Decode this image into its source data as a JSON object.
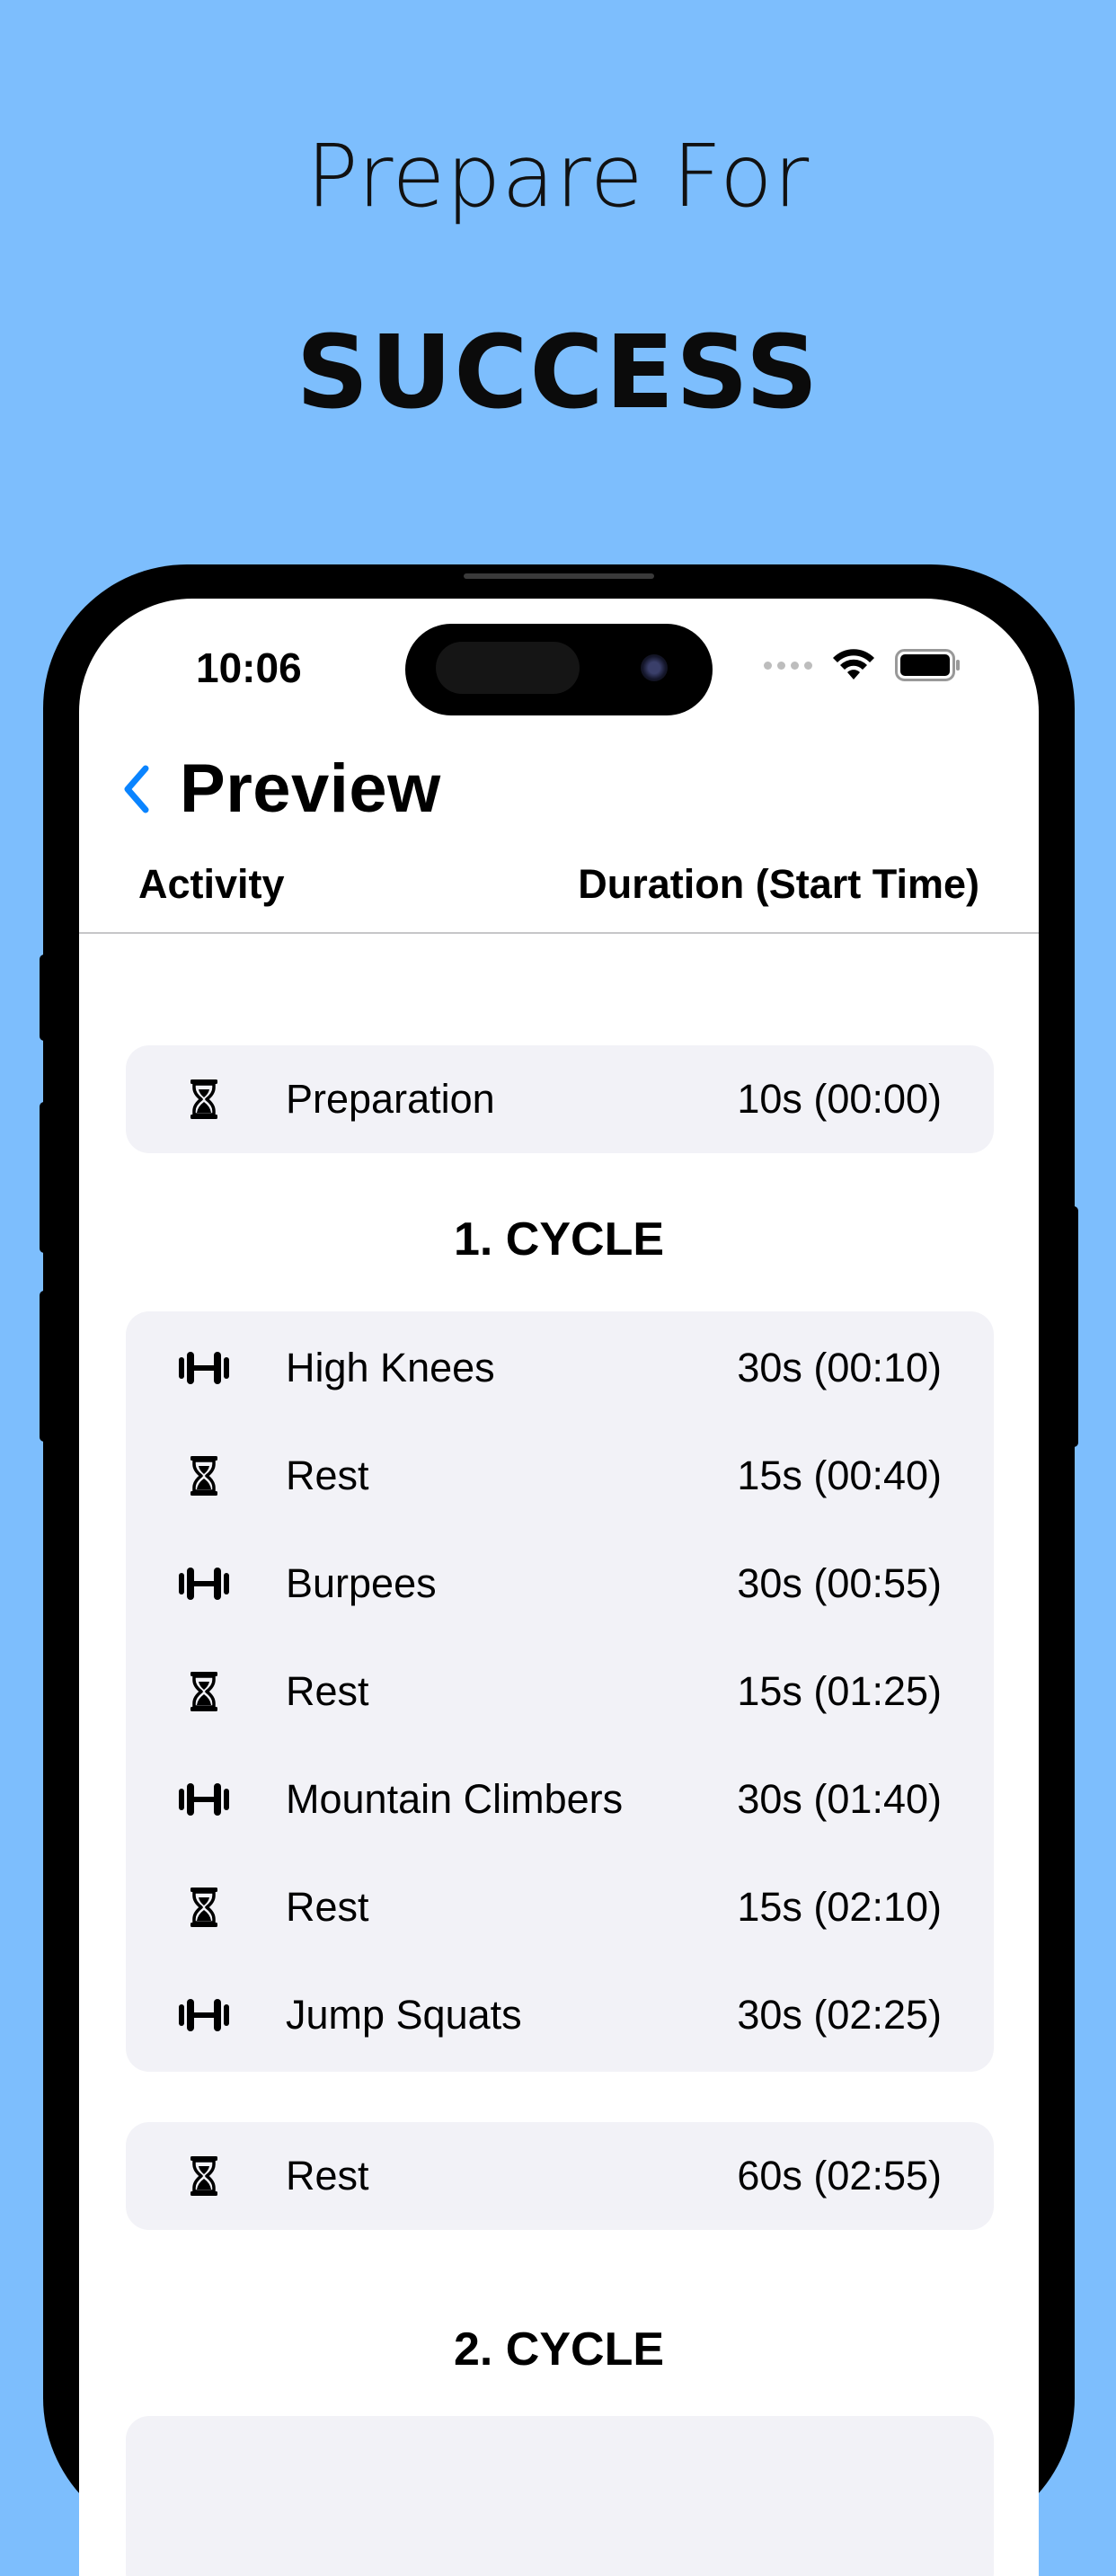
{
  "marketing": {
    "line1": "Prepare For",
    "line2": "SUCCESS"
  },
  "status_bar": {
    "time": "10:06"
  },
  "nav": {
    "title": "Preview"
  },
  "columns": {
    "activity": "Activity",
    "duration": "Duration (Start Time)"
  },
  "preparation": {
    "name": "Preparation",
    "duration": "10s (00:00)",
    "icon": "hourglass-icon"
  },
  "cycle1": {
    "title": "1. CYCLE",
    "rows": [
      {
        "name": "High Knees",
        "duration": "30s (00:10)",
        "icon": "dumbbell-icon"
      },
      {
        "name": "Rest",
        "duration": "15s (00:40)",
        "icon": "hourglass-icon"
      },
      {
        "name": "Burpees",
        "duration": "30s (00:55)",
        "icon": "dumbbell-icon"
      },
      {
        "name": "Rest",
        "duration": "15s (01:25)",
        "icon": "hourglass-icon"
      },
      {
        "name": "Mountain Climbers",
        "duration": "30s (01:40)",
        "icon": "dumbbell-icon"
      },
      {
        "name": "Rest",
        "duration": "15s (02:10)",
        "icon": "hourglass-icon"
      },
      {
        "name": "Jump Squats",
        "duration": "30s (02:25)",
        "icon": "dumbbell-icon"
      }
    ]
  },
  "rest_between": {
    "name": "Rest",
    "duration": "60s (02:55)",
    "icon": "hourglass-icon"
  },
  "cycle2": {
    "title": "2. CYCLE"
  },
  "colors": {
    "background": "#7DBEFD",
    "card": "#F2F2F7",
    "accent": "#0A84FF"
  }
}
